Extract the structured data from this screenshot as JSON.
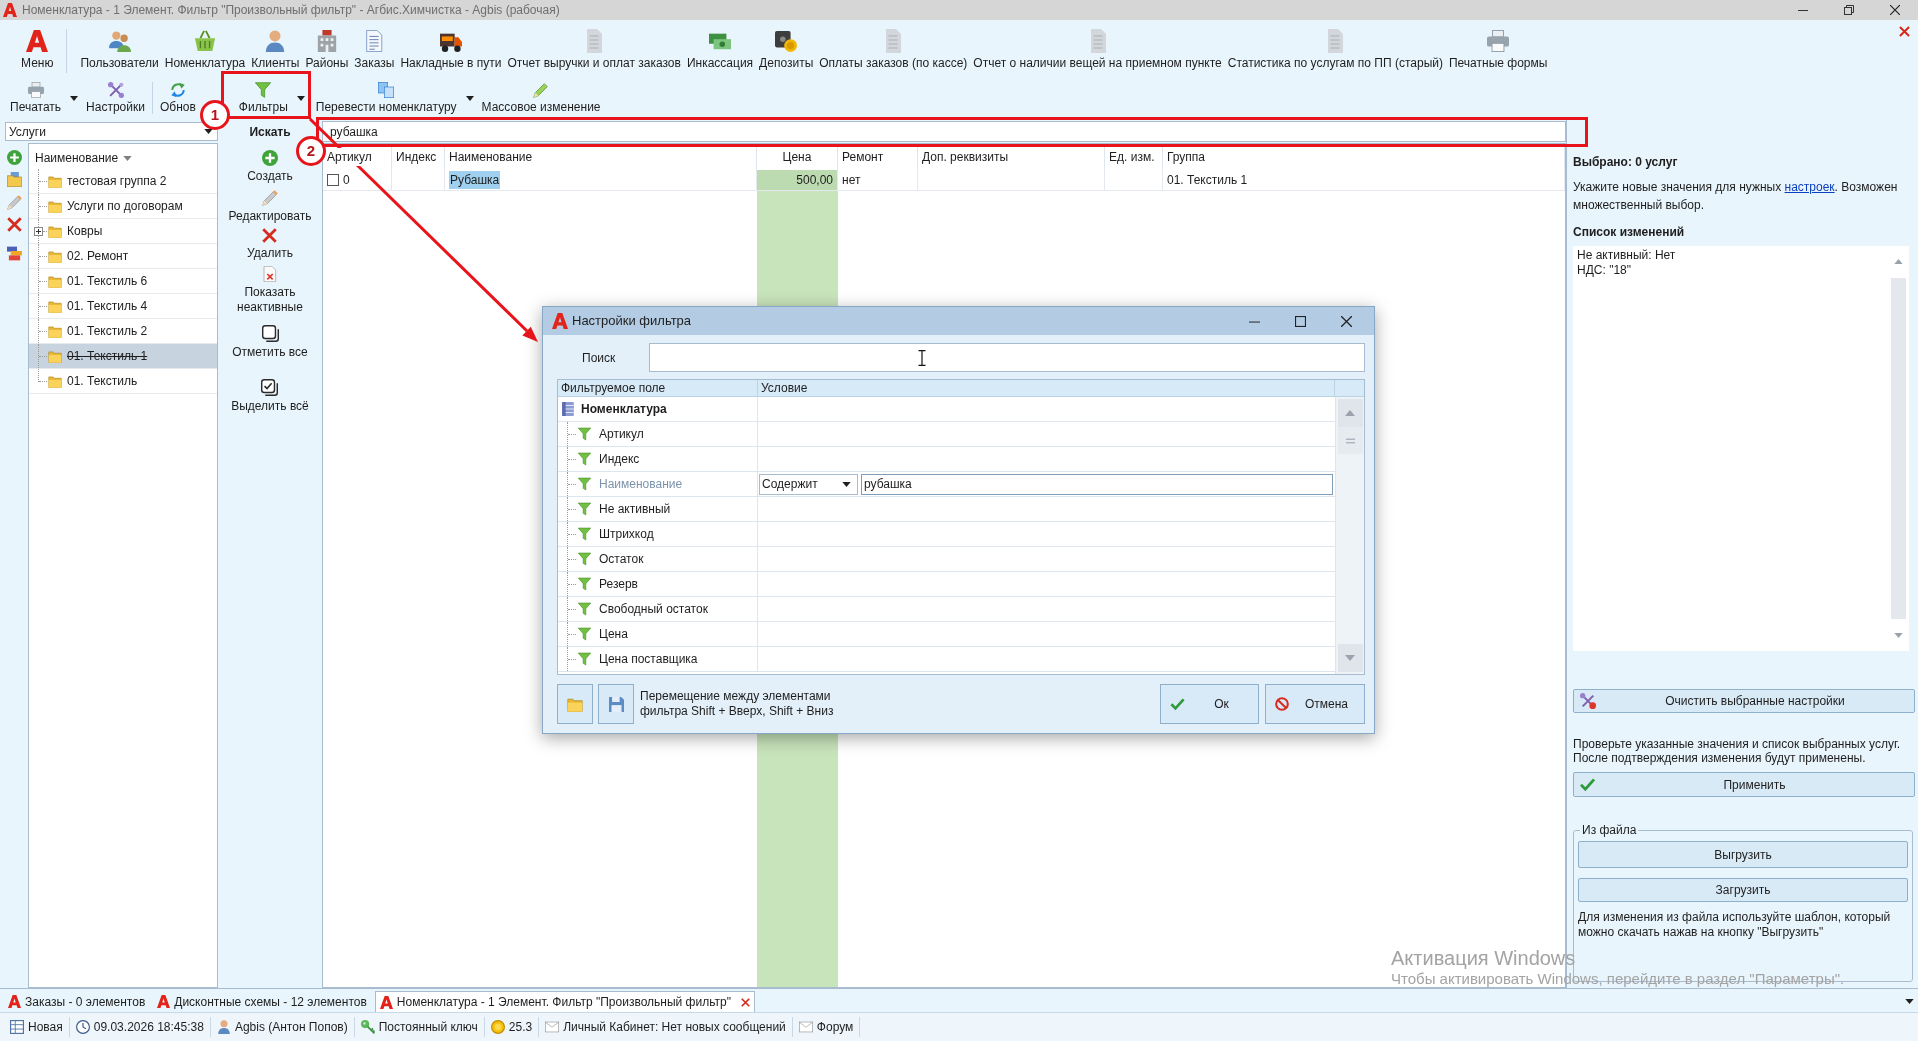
{
  "window": {
    "title": "Номенклатура - 1 Элемент. Фильтр \"Произвольный фильтр\" - Агбис.Химчистка - Agbis (рабочая)"
  },
  "ribbon": {
    "items": [
      {
        "label": "Меню"
      },
      {
        "label": "Пользователи"
      },
      {
        "label": "Номенклатура"
      },
      {
        "label": "Клиенты"
      },
      {
        "label": "Районы"
      },
      {
        "label": "Заказы"
      },
      {
        "label": "Накладные в пути"
      },
      {
        "label": "Отчет выручки и оплат заказов"
      },
      {
        "label": "Инкассация"
      },
      {
        "label": "Депозиты"
      },
      {
        "label": "Оплаты заказов (по кассе)"
      },
      {
        "label": "Отчет о наличии вещей на приемном пункте"
      },
      {
        "label": "Статистика по услугам по ПП (старый)"
      },
      {
        "label": "Печатные формы"
      }
    ]
  },
  "toolbar": {
    "items": [
      {
        "label": "Печатать",
        "dropdown": true
      },
      {
        "label": "Настройки",
        "dropdown": false
      },
      {
        "label": "Обнов",
        "dropdown": false
      },
      {
        "label": "Фильтры",
        "dropdown": true
      },
      {
        "label": "Перевести номенклатуру",
        "dropdown": true
      },
      {
        "label": "Массовое изменение",
        "dropdown": false
      }
    ]
  },
  "category_select": {
    "value": "Услуги"
  },
  "search": {
    "label": "Искать",
    "value": "рубашка"
  },
  "tree": {
    "header": "Наименование",
    "items": [
      {
        "label": "тестовая группа 2",
        "expandable": false,
        "inactive": false,
        "selected": false
      },
      {
        "label": "Услуги по договорам",
        "expandable": false,
        "inactive": false,
        "selected": false
      },
      {
        "label": "Ковры",
        "expandable": true,
        "inactive": false,
        "selected": false
      },
      {
        "label": "02. Ремонт",
        "expandable": false,
        "inactive": false,
        "selected": false
      },
      {
        "label": "01. Текстиль 6",
        "expandable": false,
        "inactive": false,
        "selected": false
      },
      {
        "label": "01. Текстиль 4",
        "expandable": false,
        "inactive": false,
        "selected": false
      },
      {
        "label": "01. Текстиль 2",
        "expandable": false,
        "inactive": false,
        "selected": false
      },
      {
        "label": "01. Текстиль 1",
        "expandable": false,
        "inactive": true,
        "selected": true
      },
      {
        "label": "01. Текстиль",
        "expandable": false,
        "inactive": false,
        "selected": false
      }
    ]
  },
  "actions": [
    {
      "label": "Создать"
    },
    {
      "label": "Редактировать"
    },
    {
      "label": "Удалить"
    },
    {
      "label": "Показать неактивные"
    },
    {
      "label": "Отметить все"
    },
    {
      "label": "Выделить всё"
    }
  ],
  "table": {
    "columns": [
      {
        "label": "Артикул"
      },
      {
        "label": "Индекс"
      },
      {
        "label": "Наименование"
      },
      {
        "label": "Цена",
        "color": "#c8e4bb"
      },
      {
        "label": "Ремонт"
      },
      {
        "label": "Доп. реквизиты"
      },
      {
        "label": "Ед. изм."
      },
      {
        "label": "Группа"
      }
    ],
    "rows": [
      {
        "checked": false,
        "article": "0",
        "name": "Рубашка",
        "name_highlighted": true,
        "price": "500,00",
        "repair": "нет",
        "group": "01. Текстиль 1"
      }
    ]
  },
  "filter_dialog": {
    "title": "Настройки фильтра",
    "search": {
      "label": "Поиск"
    },
    "columns": [
      "Фильтруемое поле",
      "Условие"
    ],
    "root": {
      "label": "Номенклатура",
      "children": [
        {
          "label": "Артикул",
          "selected": false
        },
        {
          "label": "Индекс",
          "selected": false
        },
        {
          "label": "Наименование",
          "selected": true,
          "condition": "Содержит",
          "value": "рубашка"
        },
        {
          "label": "Не активный",
          "selected": false
        },
        {
          "label": "Штрихкод",
          "selected": false
        },
        {
          "label": "Остаток",
          "selected": false
        },
        {
          "label": "Резерв",
          "selected": false
        },
        {
          "label": "Свободный остаток",
          "selected": false
        },
        {
          "label": "Цена",
          "selected": false
        },
        {
          "label": "Цена поставщика",
          "selected": false
        }
      ]
    },
    "hint": "Перемещение между элементами фильтра Shift + Вверх, Shift + Вниз",
    "buttons": [
      {
        "label": "Ок",
        "kind": "ok"
      },
      {
        "label": "Отмена",
        "kind": "cancel"
      }
    ]
  },
  "mass_edit_panel": {
    "selected_count": "Выбрано: 0 услуг",
    "instruction": {
      "before": "Укажите новые значения для нужных ",
      "link": "настроек",
      "after": ". Возможен множественный выбор."
    },
    "changes_title": "Список изменений",
    "changes": [
      "Не активный: Нет",
      "НДС: \"18\""
    ],
    "clear_button": "Очистить выбранные настройки",
    "confirm_text": "Проверьте указанные значения и список выбранных услуг. После подтверждения изменения будут применены.",
    "apply_button": "Применить",
    "file_group": {
      "title": "Из файла",
      "buttons": [
        "Выгрузить",
        "Загрузить"
      ],
      "note": "Для изменения из файла используйте шаблон, который можно скачать нажав на кнопку \"Выгрузить\""
    }
  },
  "bottom_tabs": [
    {
      "label": "Заказы - 0 элементов",
      "selected": false
    },
    {
      "label": "Дисконтные схемы - 12 элементов",
      "selected": false
    },
    {
      "label": "Номенклатура - 1 Элемент. Фильтр \"Произвольный фильтр\"",
      "selected": true
    }
  ],
  "status_bar": {
    "items": [
      {
        "text": "Новая"
      },
      {
        "text": "09.03.2026 18:45:38"
      },
      {
        "text": "Agbis (Антон Попов)"
      },
      {
        "text": "Постоянный ключ"
      },
      {
        "text": "25.3"
      },
      {
        "text": "Личный Кабинет: Нет новых сообщений"
      },
      {
        "text": "Форум"
      }
    ]
  },
  "annotations": [
    {
      "label": "1"
    },
    {
      "label": "2"
    }
  ],
  "os_notice": {
    "title": "Активация Windows",
    "text": "Чтобы активировать Windows, перейдите в раздел \"Параметры\"."
  }
}
